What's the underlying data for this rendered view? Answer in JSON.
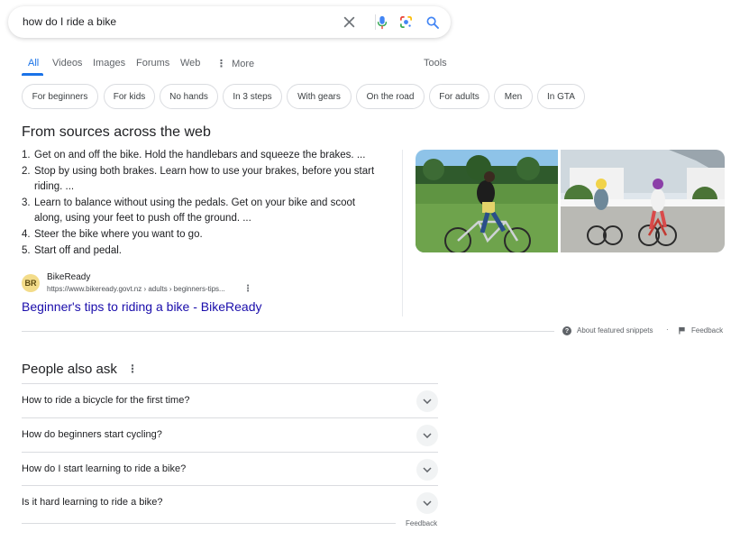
{
  "search": {
    "query": "how do I ride a bike"
  },
  "tabs": [
    {
      "label": "All",
      "active": true
    },
    {
      "label": "Videos"
    },
    {
      "label": "Images"
    },
    {
      "label": "Forums"
    },
    {
      "label": "Web"
    },
    {
      "label": "More",
      "icon": "more-vert-icon"
    },
    {
      "label": "Tools"
    }
  ],
  "chips": [
    "For beginners",
    "For kids",
    "No hands",
    "In 3 steps",
    "With gears",
    "On the road",
    "For adults",
    "Men",
    "In GTA"
  ],
  "snippet": {
    "heading": "From sources across the web",
    "steps": [
      {
        "num": "1.",
        "text": "Get on and off the bike. Hold the handlebars and squeeze the brakes. ..."
      },
      {
        "num": "2.",
        "text": "Stop by using both brakes. Learn how to use your brakes, before you start riding. ..."
      },
      {
        "num": "3.",
        "text": "Learn to balance without using the pedals. Get on your bike and scoot along, using your feet to push off the ground. ..."
      },
      {
        "num": "4.",
        "text": "Steer the bike where you want to go."
      },
      {
        "num": "5.",
        "text": "Start off and pedal."
      }
    ],
    "source": {
      "avatar_initials": "BR",
      "name": "BikeReady",
      "url": "https://www.bikeready.govt.nz › adults › beginners-tips...",
      "link_title": "Beginner's tips to riding a bike - BikeReady"
    },
    "footer": {
      "about": "About featured snippets",
      "separator": "·",
      "feedback": "Feedback"
    }
  },
  "paa": {
    "heading": "People also ask",
    "questions": [
      "How to ride a bicycle for the first time?",
      "How do beginners start cycling?",
      "How do I start learning to ride a bike?",
      "Is it hard learning to ride a bike?"
    ],
    "feedback": "Feedback"
  },
  "colors": {
    "link": "#1a0dab",
    "accent": "#1a73e8",
    "mic_blue": "#4285f4",
    "mic_red": "#ea4335"
  }
}
